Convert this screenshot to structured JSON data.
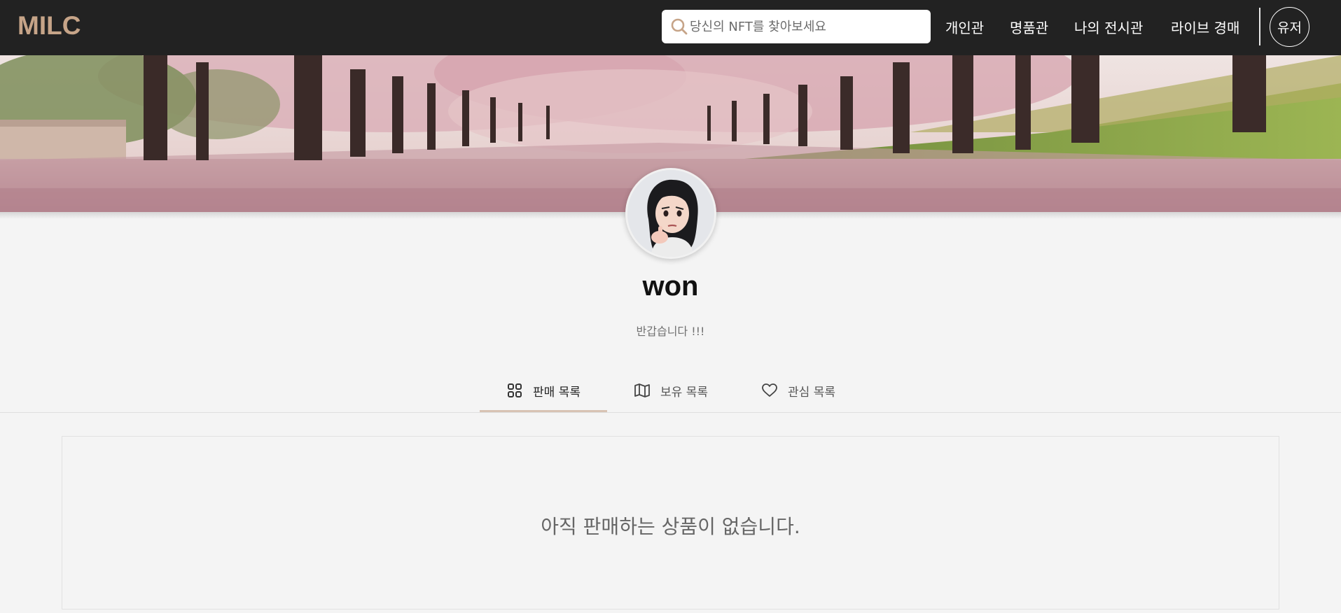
{
  "header": {
    "logo": "MILC",
    "search": {
      "placeholder": "당신의 NFT를 찾아보세요",
      "value": ""
    },
    "nav": [
      {
        "label": "개인관"
      },
      {
        "label": "명품관"
      },
      {
        "label": "나의 전시관"
      },
      {
        "label": "라이브 경매"
      }
    ],
    "user_button": "유저"
  },
  "profile": {
    "username": "won",
    "bio": "반갑습니다 !!!"
  },
  "tabs": [
    {
      "label": "판매 목록",
      "icon": "grid-icon",
      "active": true
    },
    {
      "label": "보유 목록",
      "icon": "map-icon",
      "active": false
    },
    {
      "label": "관심 목록",
      "icon": "heart-icon",
      "active": false
    }
  ],
  "content": {
    "empty_message": "아직 판매하는 상품이 없습니다."
  },
  "colors": {
    "header_bg": "#222222",
    "logo": "#c6a488",
    "search_icon": "#c6a488",
    "tab_underline": "#d8c3b3",
    "page_bg": "#f4f4f4"
  }
}
